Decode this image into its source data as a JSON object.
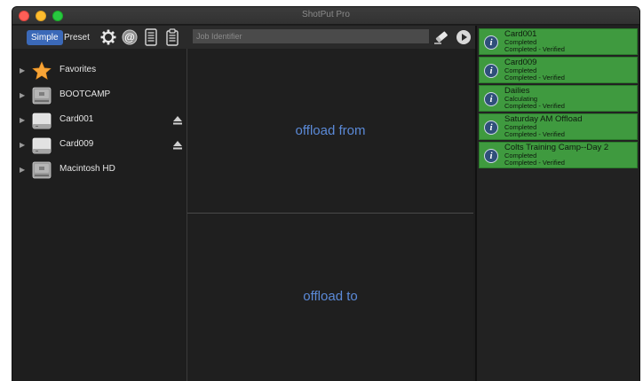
{
  "window": {
    "title": "ShotPut Pro"
  },
  "toolbar": {
    "simple_label": "Simple",
    "preset_label": "Preset",
    "job_identifier_placeholder": "Job Identifier",
    "icons": [
      "gear-icon",
      "at-icon",
      "document-icon",
      "clipboard-icon",
      "eraser-icon",
      "play-icon"
    ]
  },
  "sidebar": {
    "items": [
      {
        "label": "Favorites",
        "icon": "star-icon",
        "eject": false
      },
      {
        "label": "BOOTCAMP",
        "icon": "internal-drive-icon",
        "eject": false
      },
      {
        "label": "Card001",
        "icon": "external-drive-icon",
        "eject": true
      },
      {
        "label": "Card009",
        "icon": "external-drive-icon",
        "eject": true
      },
      {
        "label": "Macintosh HD",
        "icon": "internal-drive-icon",
        "eject": false
      }
    ]
  },
  "main": {
    "offload_from": "offload from",
    "offload_to": "offload to"
  },
  "jobs": [
    {
      "name": "Card001",
      "status1": "Completed",
      "status2": "Completed - Verified"
    },
    {
      "name": "Card009",
      "status1": "Completed",
      "status2": "Completed - Verified"
    },
    {
      "name": "Dailies",
      "status1": "Calculating",
      "status2": "Completed - Verified"
    },
    {
      "name": "Saturday AM Offload",
      "status1": "Completed",
      "status2": "Completed - Verified"
    },
    {
      "name": "Colts Training Camp--Day 2",
      "status1": "Completed",
      "status2": "Completed - Verified"
    }
  ],
  "colors": {
    "accent": "#3b69b8",
    "job_card": "#3f9a3f",
    "pane_text": "#5b8ad8",
    "star": "#f7a437"
  }
}
